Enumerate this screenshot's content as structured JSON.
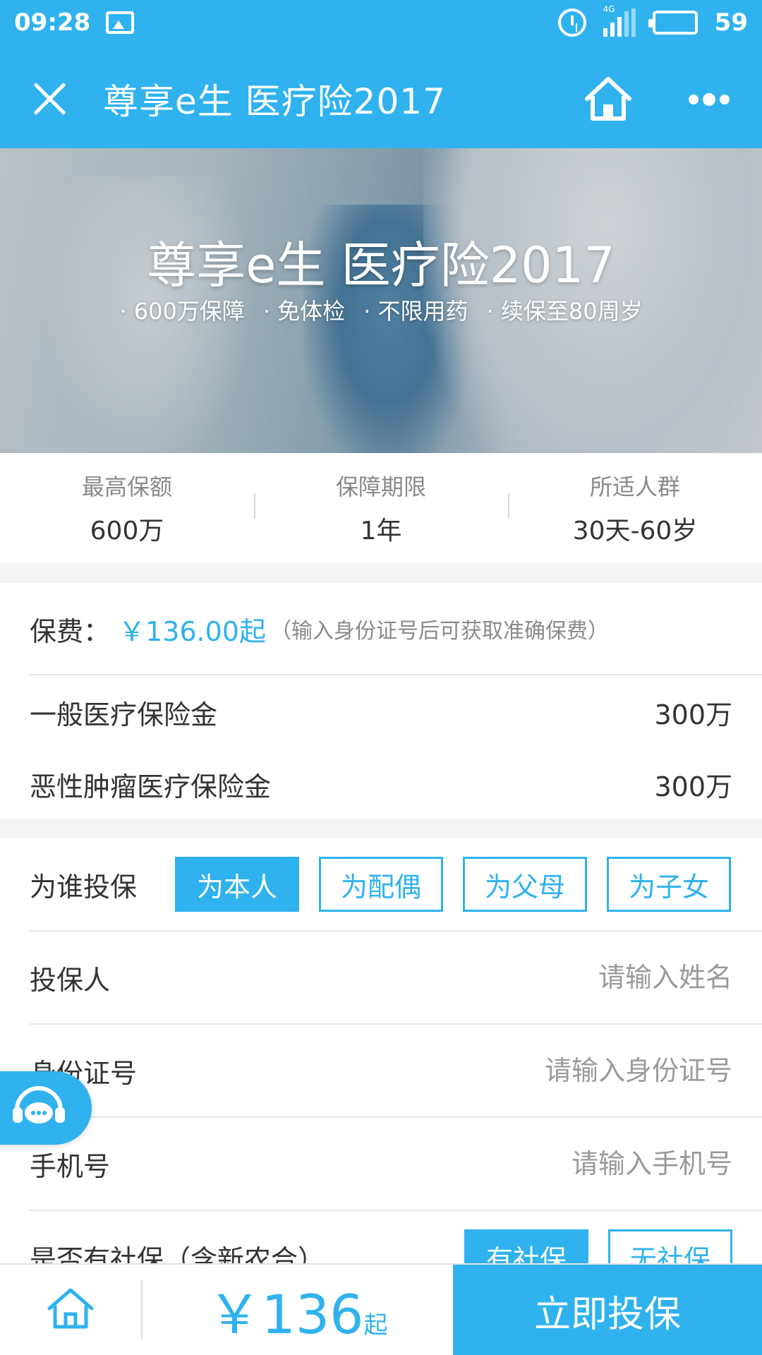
{
  "status_bar": {
    "time": "09:28",
    "network": "4G",
    "battery": "59"
  },
  "title_bar": {
    "title": "尊享e生 医疗险2017"
  },
  "banner": {
    "title": "尊享e生 医疗险2017",
    "tags": [
      "600万保障",
      "免体检",
      "不限用药",
      "续保至80周岁"
    ]
  },
  "stats": [
    {
      "label": "最高保额",
      "value": "600万"
    },
    {
      "label": "保障期限",
      "value": "1年"
    },
    {
      "label": "所适人群",
      "value": "30天-60岁"
    }
  ],
  "premium": {
    "label": "保费：",
    "price": "￥136.00起",
    "note": "（输入身份证号后可获取准确保费）"
  },
  "benefits": [
    {
      "name": "一般医疗保险金",
      "amount": "300万"
    },
    {
      "name": "恶性肿瘤医疗保险金",
      "amount": "300万"
    }
  ],
  "who": {
    "label": "为谁投保",
    "options": [
      "为本人",
      "为配偶",
      "为父母",
      "为子女"
    ],
    "selected_index": 0
  },
  "form": {
    "holder": {
      "label": "投保人",
      "placeholder": "请输入姓名"
    },
    "id": {
      "label": "身份证号",
      "placeholder": "请输入身份证号"
    },
    "phone": {
      "label": "手机号",
      "placeholder": "请输入手机号"
    }
  },
  "social": {
    "label": "是否有社保（含新农合）",
    "options": [
      "有社保",
      "无社保"
    ],
    "selected_index": 0
  },
  "bottom": {
    "currency": "￥",
    "price": "136",
    "suffix": "起",
    "buy_label": "立即投保"
  },
  "colors": {
    "accent": "#2fb2ee",
    "divider": "#e6e6e6",
    "gap": "#f2f4f6"
  },
  "icons": [
    "close-icon",
    "home-icon",
    "more-icon",
    "customer-service-icon",
    "alarm-icon",
    "signal-icon",
    "battery-icon",
    "image-icon"
  ]
}
